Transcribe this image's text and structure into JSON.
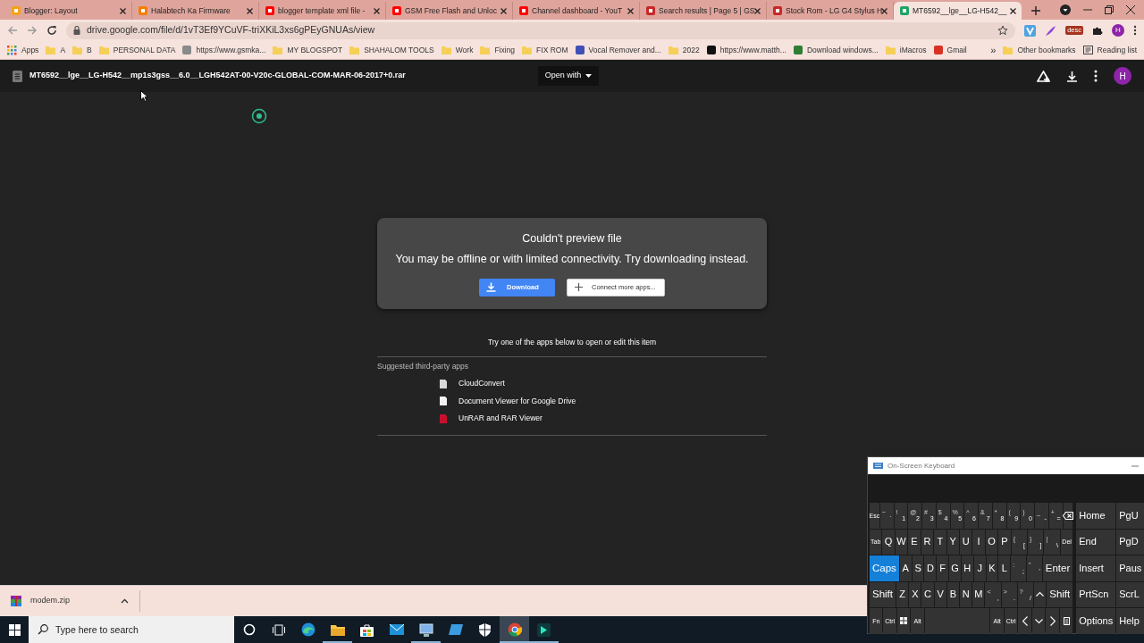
{
  "browser": {
    "tabs": [
      {
        "title": "Blogger: Layout",
        "color": "#f4a21b",
        "selected": false
      },
      {
        "title": "Halabtech Ka Firmware",
        "color": "#f57d00",
        "selected": false
      },
      {
        "title": "blogger template xml file -",
        "color": "#ff0000",
        "selected": false
      },
      {
        "title": "GSM Free Flash and Unloc",
        "color": "#ff0000",
        "selected": false
      },
      {
        "title": "Channel dashboard - YouT",
        "color": "#ff0000",
        "selected": false
      },
      {
        "title": "Search results | Page 5 | GS",
        "color": "#c62828",
        "selected": false
      },
      {
        "title": "Stock Rom - LG G4 Stylus H",
        "color": "#c62828",
        "selected": false
      },
      {
        "title": "MT6592__lge__LG-H542__",
        "color": "#1fa463",
        "selected": true
      }
    ],
    "url": "drive.google.com/file/d/1vT3Ef9YCuVF-triXKiL3xs6gPEyGNUAs/view",
    "extension_badge": "desc",
    "profile_initial": "H",
    "bookmarks": [
      {
        "label": "Apps",
        "kind": "apps"
      },
      {
        "label": "A",
        "kind": "folder"
      },
      {
        "label": "B",
        "kind": "folder"
      },
      {
        "label": "PERSONAL DATA",
        "kind": "folder"
      },
      {
        "label": "https://www.gsmka...",
        "kind": "site",
        "color": "#8a8a8a"
      },
      {
        "label": "MY BLOGSPOT",
        "kind": "folder"
      },
      {
        "label": "SHAHALOM TOOLS",
        "kind": "folder"
      },
      {
        "label": "Work",
        "kind": "folder"
      },
      {
        "label": "Fixing",
        "kind": "folder"
      },
      {
        "label": "FIX ROM",
        "kind": "folder"
      },
      {
        "label": "Vocal Remover and...",
        "kind": "site",
        "color": "#3f51b5"
      },
      {
        "label": "2022",
        "kind": "folder"
      },
      {
        "label": "https://www.matth...",
        "kind": "site",
        "color": "#111111"
      },
      {
        "label": "Download windows...",
        "kind": "site",
        "color": "#2e7d32"
      },
      {
        "label": "iMacros",
        "kind": "folder"
      },
      {
        "label": "Gmail",
        "kind": "site",
        "color": "#d93025"
      }
    ],
    "bookmarks_more": "»",
    "bookmarks_right": [
      {
        "label": "Other bookmarks",
        "kind": "folder"
      },
      {
        "label": "Reading list",
        "kind": "reading"
      }
    ]
  },
  "viewer": {
    "file_name": "MT6592__lge__LG-H542__mp1s3gss__6.0__LGH542AT-00-V20c-GLOBAL-COM-MAR-06-2017+0.rar",
    "open_with": "Open with",
    "avatar": "H",
    "dialog": {
      "title": "Couldn't preview file",
      "message": "You may be offline or with limited connectivity. Try downloading instead.",
      "buttons": [
        {
          "label": "Download",
          "kind": "primary"
        },
        {
          "label": "Connect more apps...",
          "kind": "secondary"
        }
      ]
    },
    "apps_hint": "Try one of the apps below to open or edit this item",
    "apps_heading": "Suggested third-party apps",
    "apps": [
      {
        "name": "CloudConvert",
        "color": "#d9d9d9"
      },
      {
        "name": "Document Viewer for Google Drive",
        "color": "#f1f1f1"
      },
      {
        "name": "UnRAR and RAR Viewer",
        "color": "#c8102e"
      }
    ]
  },
  "downloads": [
    {
      "file": "modem.zip"
    }
  ],
  "taskbar": {
    "search_placeholder": "Type here to search",
    "apps": [
      {
        "kind": "cortana",
        "selected": false,
        "running": false
      },
      {
        "kind": "taskview",
        "selected": false,
        "running": false
      },
      {
        "kind": "edge",
        "selected": false,
        "running": false
      },
      {
        "kind": "explorer",
        "selected": false,
        "running": true
      },
      {
        "kind": "store",
        "selected": false,
        "running": false
      },
      {
        "kind": "mail",
        "selected": false,
        "running": false
      },
      {
        "kind": "remote",
        "selected": false,
        "running": true
      },
      {
        "kind": "photos",
        "selected": false,
        "running": false
      },
      {
        "kind": "security",
        "selected": false,
        "running": false
      },
      {
        "kind": "chrome",
        "selected": true,
        "running": true
      },
      {
        "kind": "app",
        "selected": false,
        "running": true
      }
    ]
  },
  "keyboard": {
    "title": "On-Screen Keyboard",
    "keys": [
      [
        {
          "label": "Esc",
          "kind": "small"
        },
        {
          "label": "`",
          "shift": "~",
          "kind": "sym"
        },
        {
          "label": "1",
          "shift": "!",
          "kind": "sym"
        },
        {
          "label": "2",
          "shift": "@",
          "kind": "sym"
        },
        {
          "label": "3",
          "shift": "#",
          "kind": "sym"
        },
        {
          "label": "4",
          "shift": "$",
          "kind": "sym"
        },
        {
          "label": "5",
          "shift": "%",
          "kind": "sym"
        },
        {
          "label": "6",
          "shift": "^",
          "kind": "sym"
        },
        {
          "label": "7",
          "shift": "&",
          "kind": "sym"
        },
        {
          "label": "8",
          "shift": "*",
          "kind": "sym"
        },
        {
          "label": "9",
          "shift": "(",
          "kind": "sym"
        },
        {
          "label": "0",
          "shift": ")",
          "kind": "sym"
        },
        {
          "label": "-",
          "shift": "_",
          "kind": "sym"
        },
        {
          "label": "=",
          "shift": "+",
          "kind": "sym"
        },
        {
          "kind": "backspace"
        }
      ],
      [
        {
          "label": "Tab",
          "kind": "small"
        },
        {
          "label": "Q",
          "kind": "char"
        },
        {
          "label": "W",
          "kind": "char"
        },
        {
          "label": "E",
          "kind": "char"
        },
        {
          "label": "R",
          "kind": "char"
        },
        {
          "label": "T",
          "kind": "char"
        },
        {
          "label": "Y",
          "kind": "char"
        },
        {
          "label": "U",
          "kind": "char"
        },
        {
          "label": "I",
          "kind": "char"
        },
        {
          "label": "O",
          "kind": "char"
        },
        {
          "label": "P",
          "kind": "char"
        },
        {
          "label": "[",
          "shift": "{",
          "kind": "sym"
        },
        {
          "label": "]",
          "shift": "}",
          "kind": "sym"
        },
        {
          "label": "\\",
          "shift": "|",
          "kind": "sym"
        },
        {
          "label": "Del",
          "kind": "small"
        }
      ],
      [
        {
          "label": "Caps",
          "kind": "word",
          "on": true
        },
        {
          "label": "A",
          "kind": "char"
        },
        {
          "label": "S",
          "kind": "char"
        },
        {
          "label": "D",
          "kind": "char"
        },
        {
          "label": "F",
          "kind": "char"
        },
        {
          "label": "G",
          "kind": "char"
        },
        {
          "label": "H",
          "kind": "char"
        },
        {
          "label": "J",
          "kind": "char"
        },
        {
          "label": "K",
          "kind": "char"
        },
        {
          "label": "L",
          "kind": "char"
        },
        {
          "label": ";",
          "shift": ":",
          "kind": "sym"
        },
        {
          "label": "'",
          "shift": "\"",
          "kind": "sym"
        },
        {
          "label": "Enter",
          "kind": "word"
        }
      ],
      [
        {
          "label": "Shift",
          "kind": "word",
          "on": false
        },
        {
          "label": "Z",
          "kind": "char"
        },
        {
          "label": "X",
          "kind": "char"
        },
        {
          "label": "C",
          "kind": "char"
        },
        {
          "label": "V",
          "kind": "char"
        },
        {
          "label": "B",
          "kind": "char"
        },
        {
          "label": "N",
          "kind": "char"
        },
        {
          "label": "M",
          "kind": "char"
        },
        {
          "label": ",",
          "shift": "<",
          "kind": "sym"
        },
        {
          "label": ".",
          "shift": ">",
          "kind": "sym"
        },
        {
          "label": "/",
          "shift": "?",
          "kind": "sym"
        },
        {
          "kind": "up"
        },
        {
          "label": "Shift",
          "kind": "word",
          "on": false
        }
      ],
      [
        {
          "label": "Fn",
          "kind": "small",
          "on": false
        },
        {
          "label": "Ctrl",
          "kind": "small",
          "on": false
        },
        {
          "kind": "win"
        },
        {
          "label": "Alt",
          "kind": "small",
          "on": false
        },
        {
          "kind": "space"
        },
        {
          "label": "Alt",
          "kind": "small",
          "on": false
        },
        {
          "label": "Ctrl",
          "kind": "small",
          "on": false
        },
        {
          "kind": "left"
        },
        {
          "kind": "down"
        },
        {
          "kind": "right"
        },
        {
          "kind": "menu"
        }
      ]
    ],
    "nav_keys": [
      [
        {
          "label": "Home"
        },
        {
          "label": "PgU"
        }
      ],
      [
        {
          "label": "End"
        },
        {
          "label": "PgD"
        }
      ],
      [
        {
          "label": "Insert"
        },
        {
          "label": "Paus"
        }
      ],
      [
        {
          "label": "PrtScn"
        },
        {
          "label": "ScrL"
        }
      ],
      [
        {
          "label": "Options"
        },
        {
          "label": "Help"
        }
      ]
    ]
  }
}
